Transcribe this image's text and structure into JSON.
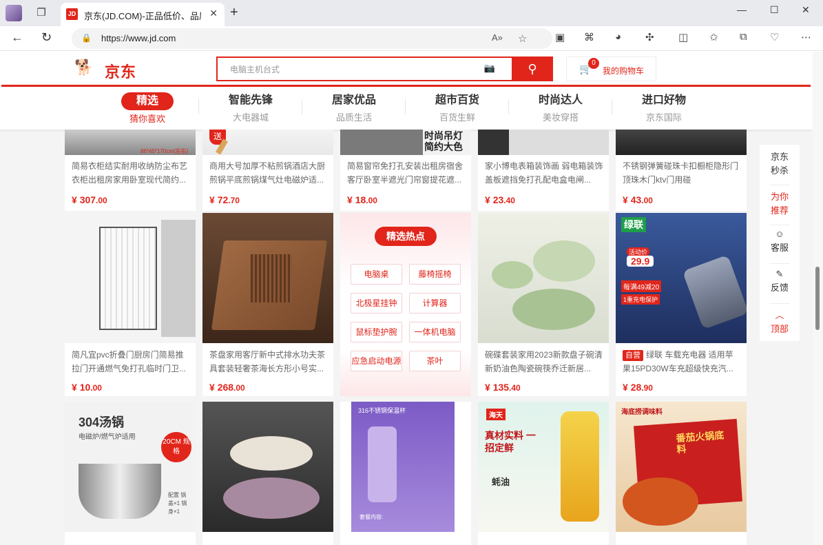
{
  "browser": {
    "tab_title": "京东(JD.COM)-正品低价、品质保障",
    "tab_favicon": "JD",
    "url": "https://www.jd.com",
    "icons": {
      "back": "back-arrow-icon",
      "refresh": "refresh-icon",
      "lock": "lock-icon",
      "read_aloud": "read-aloud-icon",
      "favorite": "star-icon"
    }
  },
  "header": {
    "logo_text": "京东",
    "search_placeholder": "电脑主机台式",
    "cart_count": "0",
    "cart_label": "我的购物车"
  },
  "categories": [
    {
      "main": "精选",
      "sub": "猜你喜欢",
      "active": true
    },
    {
      "main": "智能先锋",
      "sub": "大电器城"
    },
    {
      "main": "居家优品",
      "sub": "品质生活"
    },
    {
      "main": "超市百货",
      "sub": "百货生鲜"
    },
    {
      "main": "时尚达人",
      "sub": "美妆穿搭"
    },
    {
      "main": "进口好物",
      "sub": "京东国际"
    }
  ],
  "products_row1": [
    {
      "title": "简易衣柜结实耐用收纳防尘布艺衣柜出租房家用卧室现代简约...",
      "price_int": "307",
      "price_dec": ".00",
      "img_text": "86*45*170cm(左右)"
    },
    {
      "title": "商用大号加厚不粘煎锅酒店大厨煎锅平底煎锅煤气灶电磁炉适...",
      "price_int": "72",
      "price_dec": ".70",
      "img_text": "送"
    },
    {
      "title": "简易窗帘免打孔安装出租房宿舍客厅卧室半遮光门帘窗提花遮...",
      "price_int": "18",
      "price_dec": ".00",
      "img_text": "时尚吊灯 简约大色"
    },
    {
      "title": "家小博电表箱装饰画 弱电箱装饰盖板遮挡免打孔配电盒电闸...",
      "price_int": "23",
      "price_dec": ".40",
      "img_text": ""
    },
    {
      "title": "不锈钢弹簧碰珠卡扣橱柜隐形门顶珠木门ktv门用碰",
      "price_int": "43",
      "price_dec": ".00",
      "img_text": ""
    }
  ],
  "products_row2": [
    {
      "title": "简凡宜pvc折叠门厨房门简易推拉门开通燃气免打孔临时门卫...",
      "price_int": "10",
      "price_dec": ".00"
    },
    {
      "title": "茶盘家用客厅新中式排水功夫茶具套装轻奢茶海长方形小号实...",
      "price_int": "268",
      "price_dec": ".00"
    },
    {
      "title": "碗碟套装家用2023新款盘子碗清新奶油色陶瓷碗筷乔迁新居...",
      "price_int": "135",
      "price_dec": ".40"
    },
    {
      "tag": "自营",
      "title": "绿联 车载充电器 适用苹果15PD30W车充超级快充汽...",
      "price_int": "28",
      "price_dec": ".90",
      "img_brand": "绿联",
      "img_badge1": "活动价",
      "img_badge2": "29.9",
      "img_badge3": "每满49减20",
      "img_badge4": "1重充电保护"
    }
  ],
  "hot": {
    "title": "精选热点",
    "items": [
      "电脑桌",
      "藤椅摇椅",
      "北极星挂钟",
      "计算器",
      "鼠标垫护腕",
      "一体机电脑",
      "应急启动电源",
      "茶叶"
    ]
  },
  "products_row3": [
    {
      "img_title": "304汤锅",
      "img_sub": "电磁炉/燃气炉适用",
      "img_badge": "20CM 规格",
      "img_note": "配置 锅盖×1 锅身×1"
    },
    {
      "img_title": ""
    },
    {
      "img_title": "316不锈钢保温杯",
      "img_note": "套餐内容:"
    },
    {
      "img_brand": "海天",
      "img_title": "真材实料 一招定鲜",
      "img_sub": "蚝油"
    },
    {
      "img_brand": "海底捞调味料",
      "img_title": "番茄火锅底料"
    }
  ],
  "sidebar": {
    "items": [
      "京东秒杀",
      "为你推荐",
      "客服",
      "反馈",
      "顶部"
    ]
  }
}
